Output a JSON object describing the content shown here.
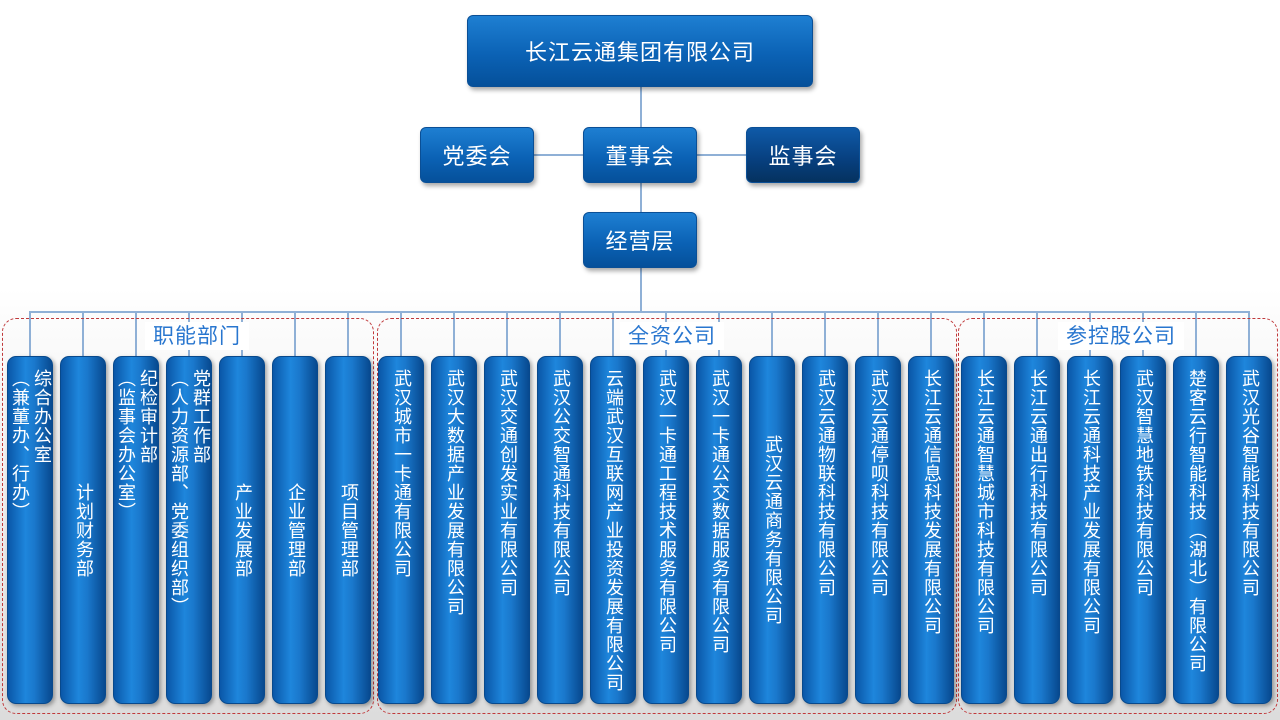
{
  "company": "长江云通集团有限公司",
  "party_committee": "党委会",
  "board": "董事会",
  "supervisory_board": "监事会",
  "management": "经营层",
  "groups": {
    "functional": "职能部门",
    "wholly_owned": "全资公司",
    "holding": "参控股公司"
  },
  "functional_departments": [
    "综合办公室\n（兼董办、行办）",
    "计划财务部",
    "纪检审计部\n（监事会办公室）",
    "党群工作部\n（人力资源部、党委组织部）",
    "产业发展部",
    "企业管理部",
    "项目管理部"
  ],
  "wholly_owned_companies": [
    "武汉城市一卡通有限公司",
    "武汉大数据产业发展有限公司",
    "武汉交通创发实业有限公司",
    "武汉公交智通科技有限公司",
    "云端武汉互联网产业投资发展有限公司",
    "武汉一卡通工程技术服务有限公司",
    "武汉一卡通公交数据服务有限公司",
    "武汉云通商务有限公司",
    "武汉云通物联科技有限公司",
    "武汉云通停呗科技有限公司",
    "长江云通信息科技发展有限公司"
  ],
  "holding_companies": [
    "长江云通智慧城市科技有限公司",
    "长江云通出行科技有限公司",
    "长江云通科技产业发展有限公司",
    "武汉智慧地铁科技有限公司",
    "楚客云行智能科技（湖北）有限公司",
    "武汉光谷智能科技有限公司"
  ]
}
